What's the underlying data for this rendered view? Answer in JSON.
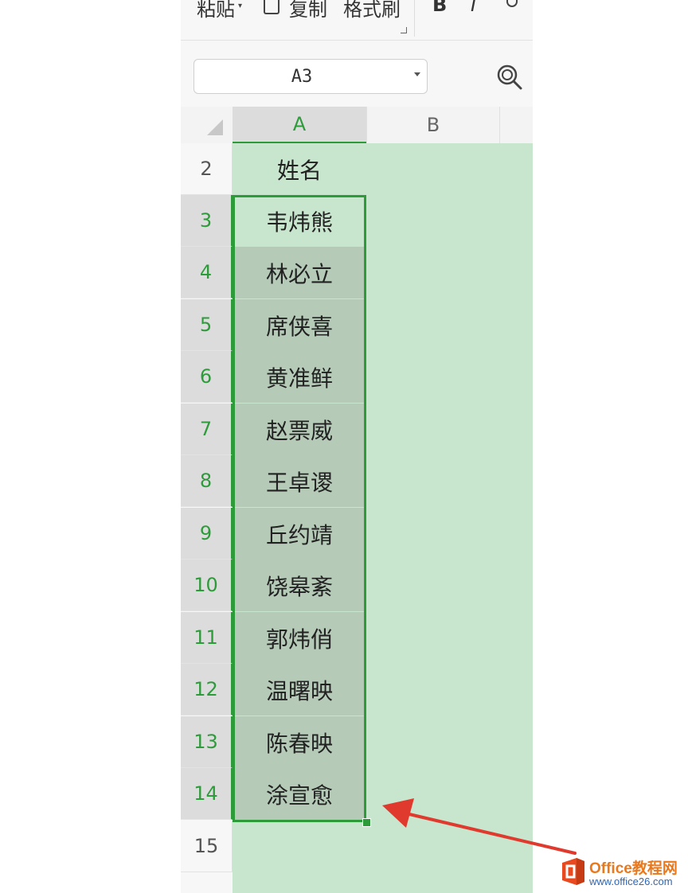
{
  "ribbon": {
    "paste_label": "粘贴",
    "copy_label": "复制",
    "format_painter_label": "格式刷",
    "bold_label": "B",
    "italic_label": "I"
  },
  "name_box": {
    "value": "A3"
  },
  "columns": [
    "A",
    "B"
  ],
  "row_numbers": [
    "2",
    "3",
    "4",
    "5",
    "6",
    "7",
    "8",
    "9",
    "10",
    "11",
    "12",
    "13",
    "14",
    "15"
  ],
  "column_a": [
    "姓名",
    "韦炜熊",
    "林必立",
    "席侠喜",
    "黄准鲜",
    "赵票威",
    "王卓谡",
    "丘约靖",
    "饶皋紊",
    "郭炜俏",
    "温曙映",
    "陈春映",
    "涂宣愈",
    ""
  ],
  "selection": {
    "range_start": "A3",
    "range_end": "A14"
  },
  "colors": {
    "accent": "#2e9b3b",
    "sheet_background": "#c8e5cd",
    "selection_fill": "#b5cbb8",
    "arrow": "#e03a2e"
  },
  "watermark": {
    "name": "Office教程网",
    "url": "www.office26.com"
  }
}
